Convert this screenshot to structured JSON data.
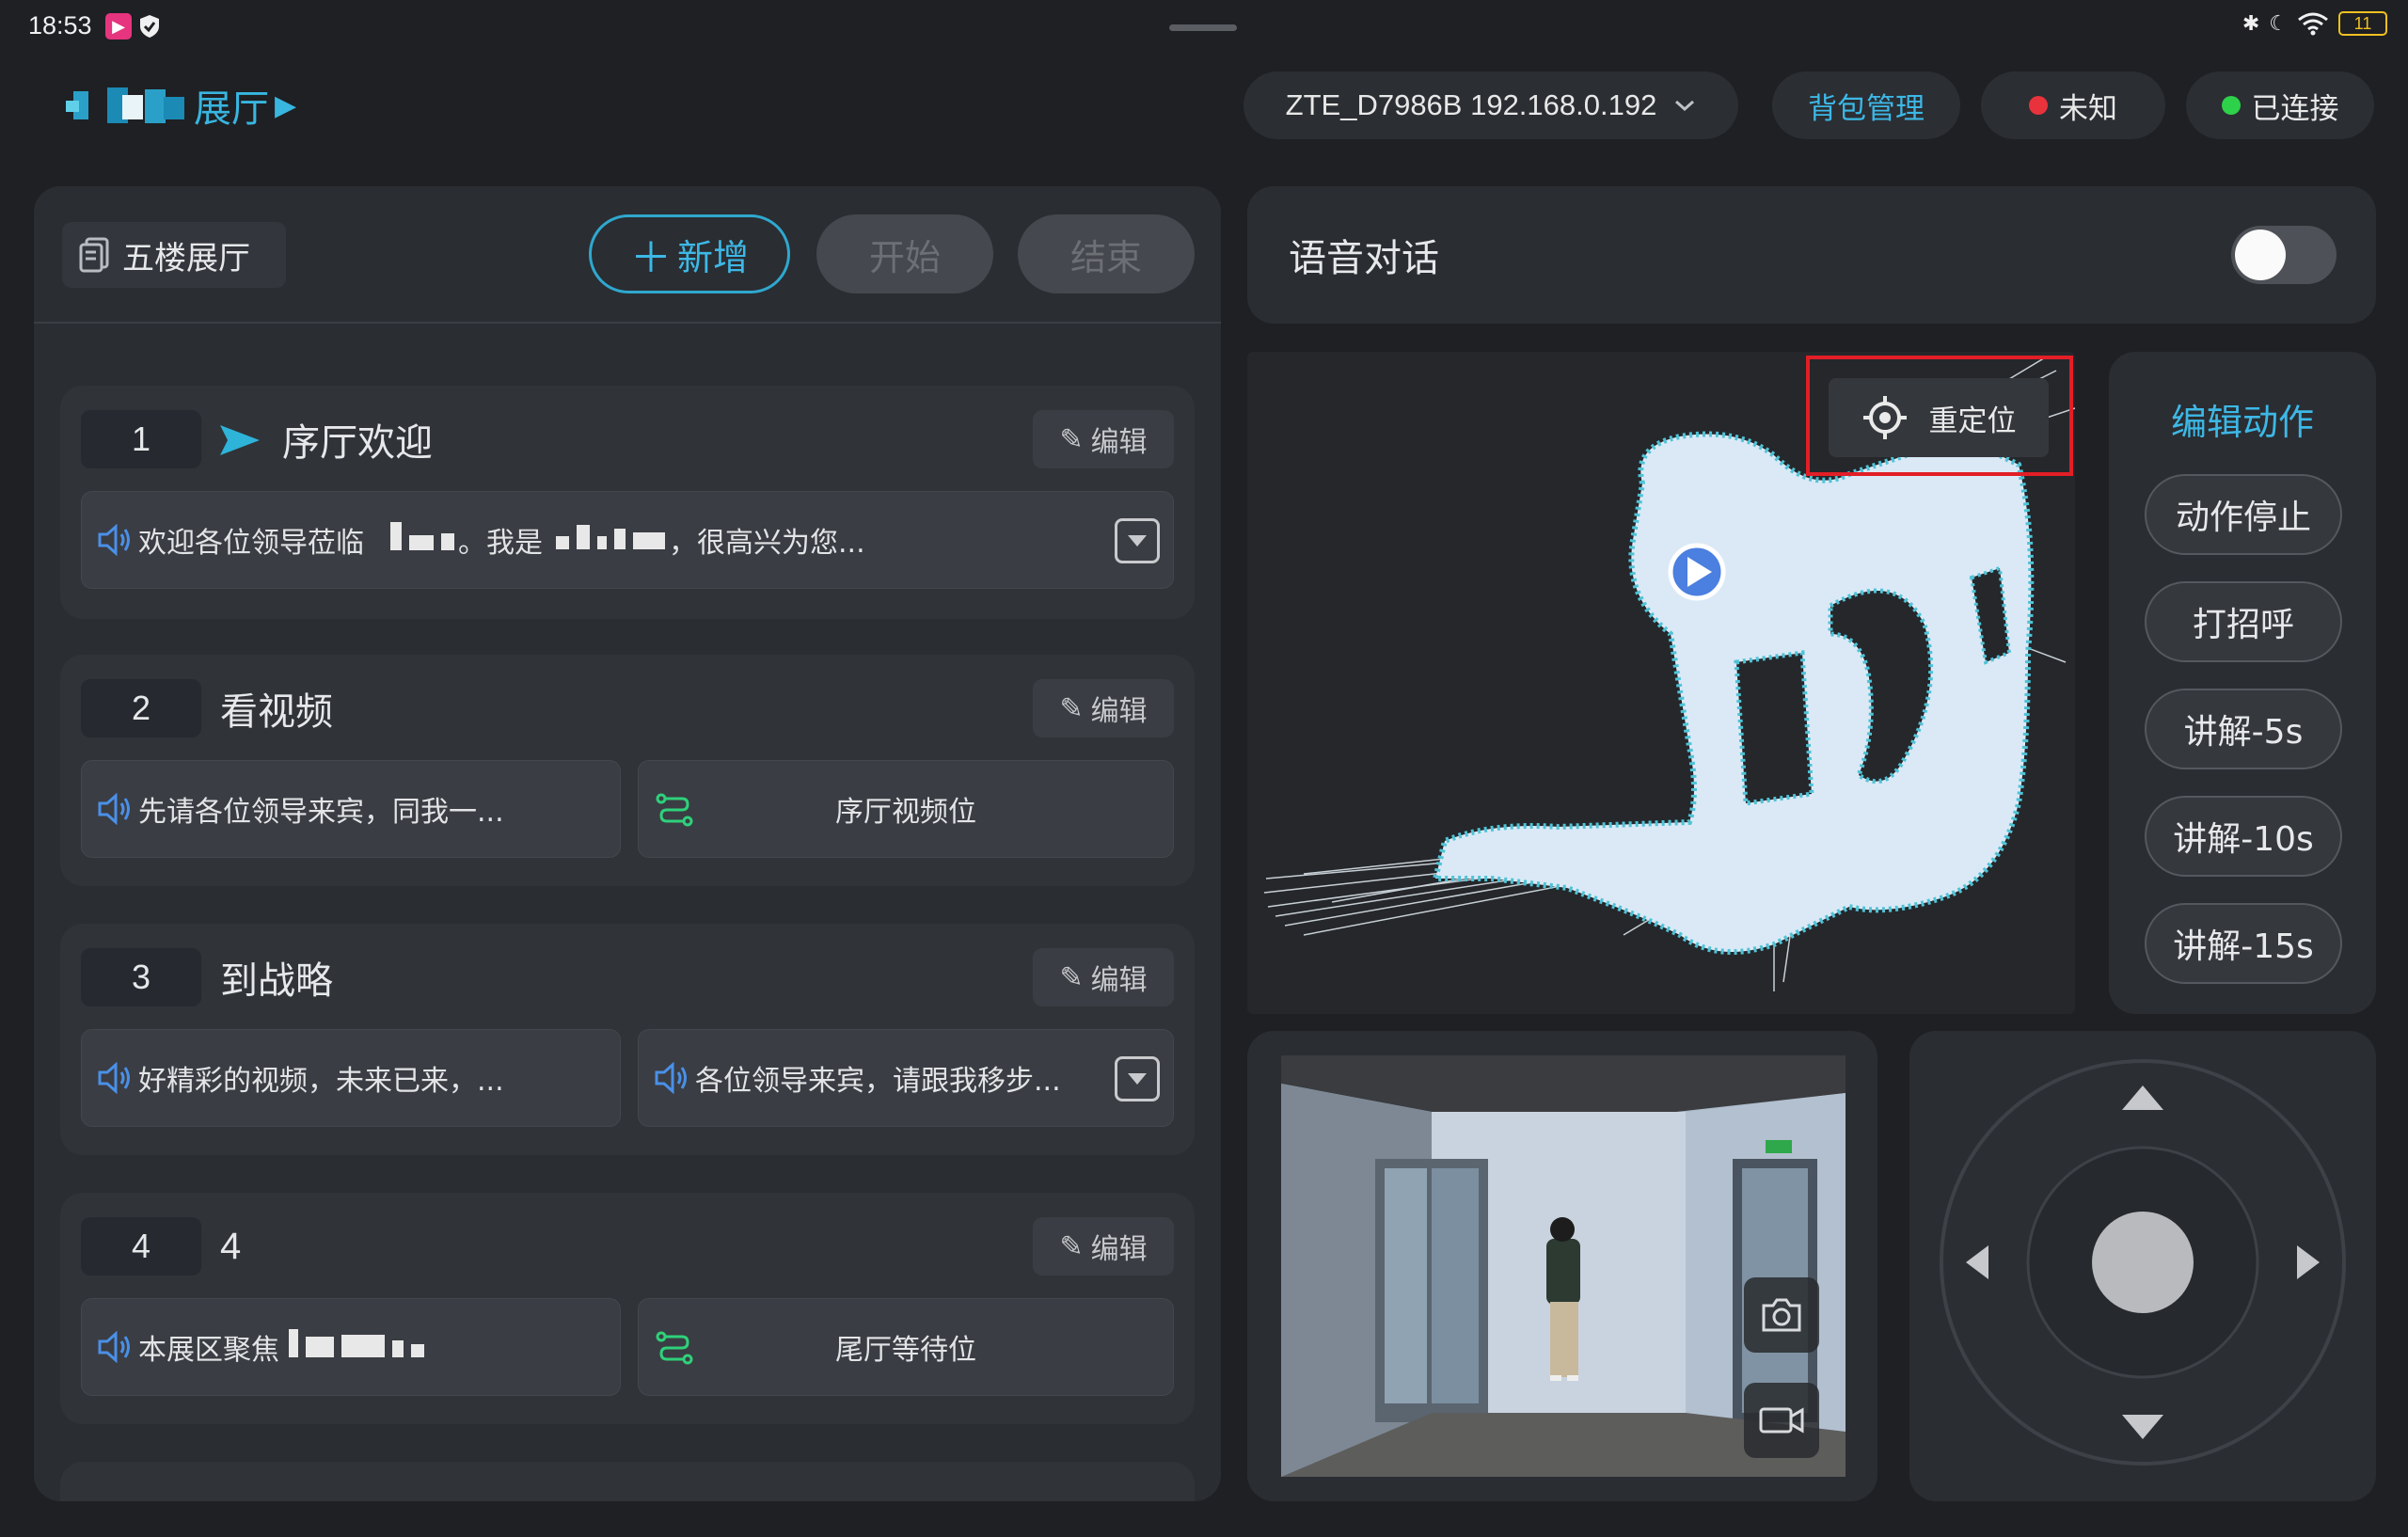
{
  "status_bar": {
    "time": "18:53",
    "battery": "11"
  },
  "header": {
    "title": "展厅",
    "wifi": "ZTE_D7986B 192.168.0.192",
    "backpack_label": "背包管理",
    "unknown_label": "未知",
    "connected_label": "已连接"
  },
  "left": {
    "floor": "五楼展厅",
    "add_label": "新增",
    "start_label": "开始",
    "end_label": "结束",
    "edit_label": "编辑",
    "steps": [
      {
        "num": "1",
        "title": "序厅欢迎",
        "speech1": "欢迎各位领导莅临",
        "speech1b": "。我是",
        "speech1c": "，很高兴为您..."
      },
      {
        "num": "2",
        "title": "看视频",
        "speech1": "先请各位领导来宾，同我一...",
        "route": "序厅视频位"
      },
      {
        "num": "3",
        "title": "到战略",
        "speech1": "好精彩的视频，未来已来，...",
        "speech2": "各位领导来宾，请跟我移步..."
      },
      {
        "num": "4",
        "title": "4",
        "speech1": "本展区聚焦",
        "route": "尾厅等待位"
      }
    ]
  },
  "voice": {
    "title": "语音对话",
    "enabled": false
  },
  "map": {
    "relocate_label": "重定位"
  },
  "actions": {
    "title": "编辑动作",
    "items": [
      "动作停止",
      "打招呼",
      "讲解-5s",
      "讲解-10s",
      "讲解-15s"
    ]
  },
  "colors": {
    "accent": "#3db8e6",
    "red_dot": "#e8323c",
    "green_dot": "#2ed14a",
    "highlight": "#e21e26"
  }
}
